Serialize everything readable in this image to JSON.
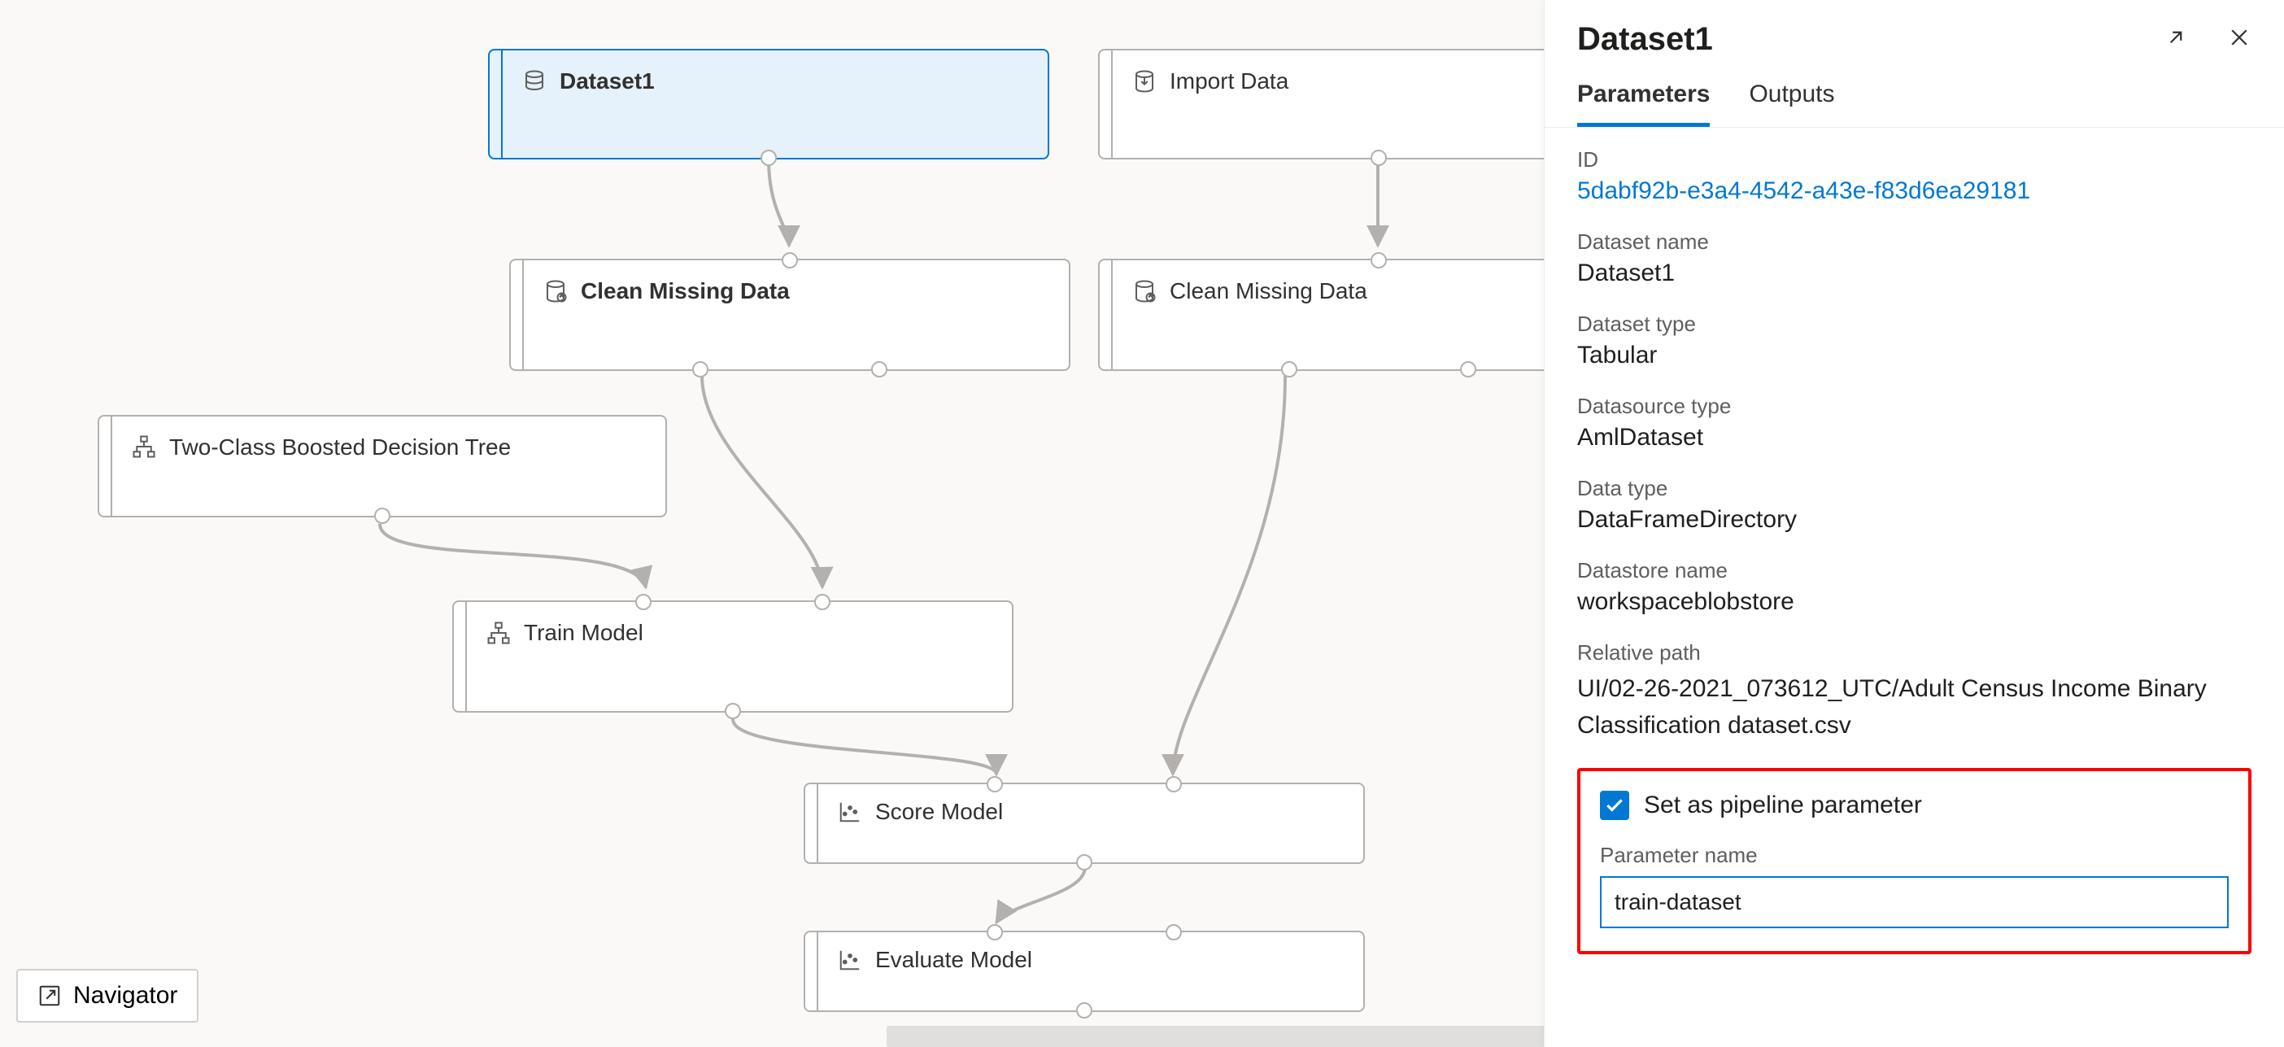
{
  "nodes": {
    "dataset1": {
      "label": "Dataset1"
    },
    "import_data": {
      "label": "Import Data"
    },
    "clean1": {
      "label": "Clean Missing Data"
    },
    "clean2": {
      "label": "Clean Missing Data"
    },
    "tree": {
      "label": "Two-Class Boosted Decision Tree"
    },
    "train": {
      "label": "Train Model"
    },
    "score": {
      "label": "Score Model"
    },
    "evaluate": {
      "label": "Evaluate Model"
    }
  },
  "navigator": {
    "label": "Navigator"
  },
  "panel": {
    "title": "Dataset1",
    "tabs": {
      "parameters": "Parameters",
      "outputs": "Outputs"
    },
    "fields": {
      "id_label": "ID",
      "id_value": "5dabf92b-e3a4-4542-a43e-f83d6ea29181",
      "dataset_name_label": "Dataset name",
      "dataset_name_value": "Dataset1",
      "dataset_type_label": "Dataset type",
      "dataset_type_value": "Tabular",
      "datasource_type_label": "Datasource type",
      "datasource_type_value": "AmlDataset",
      "data_type_label": "Data type",
      "data_type_value": "DataFrameDirectory",
      "datastore_name_label": "Datastore name",
      "datastore_name_value": "workspaceblobstore",
      "relative_path_label": "Relative path",
      "relative_path_value": "UI/02-26-2021_073612_UTC/Adult Census Income Binary Classification dataset.csv"
    },
    "pipeline": {
      "checkbox_label": "Set as pipeline parameter",
      "checkbox_checked": true,
      "parameter_name_label": "Parameter name",
      "parameter_name_value": "train-dataset"
    }
  }
}
